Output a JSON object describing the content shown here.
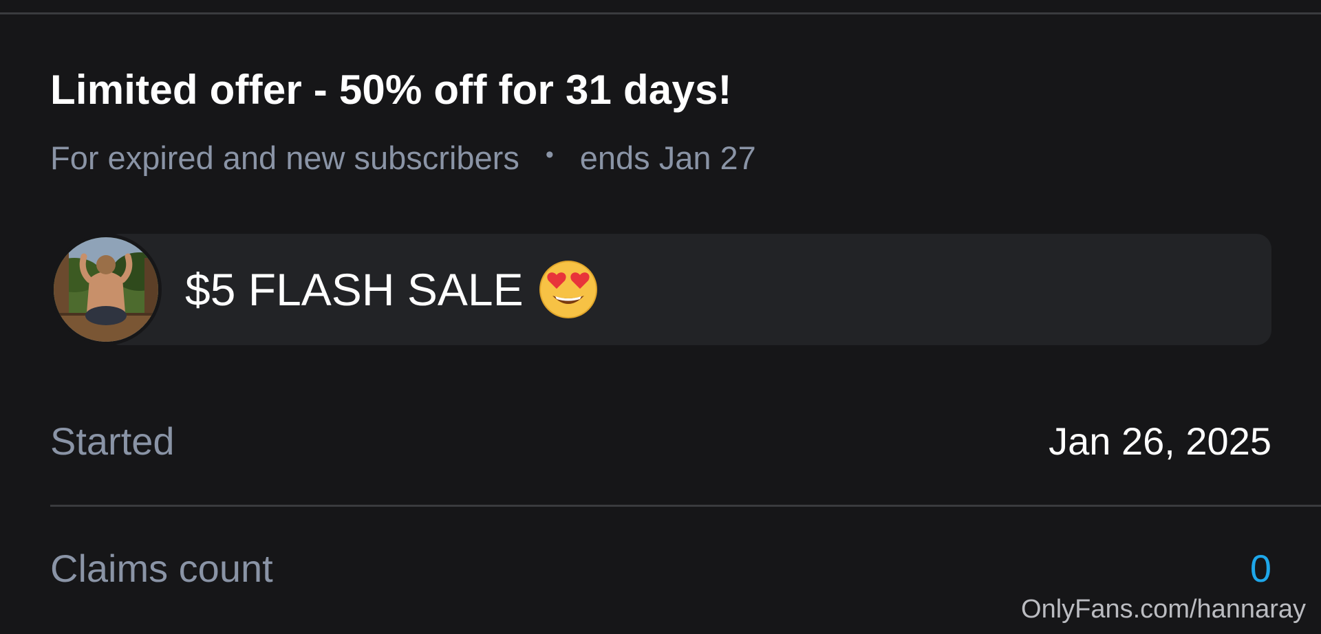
{
  "promo": {
    "title": "Limited offer - 50% off for 31 days!",
    "audience": "For expired and new subscribers",
    "separator": "•",
    "ends": "ends Jan 27"
  },
  "message": {
    "text": "$5 FLASH SALE",
    "emoji_icon": "heart-eyes-emoji-icon"
  },
  "details": {
    "started_label": "Started",
    "started_value": "Jan 26, 2025",
    "claims_label": "Claims count",
    "claims_value": "0"
  },
  "watermark": "OnlyFans.com/hannaray",
  "colors": {
    "background": "#161618",
    "card": "#222326",
    "muted_text": "#8a94a6",
    "accent": "#1ea7ea"
  }
}
